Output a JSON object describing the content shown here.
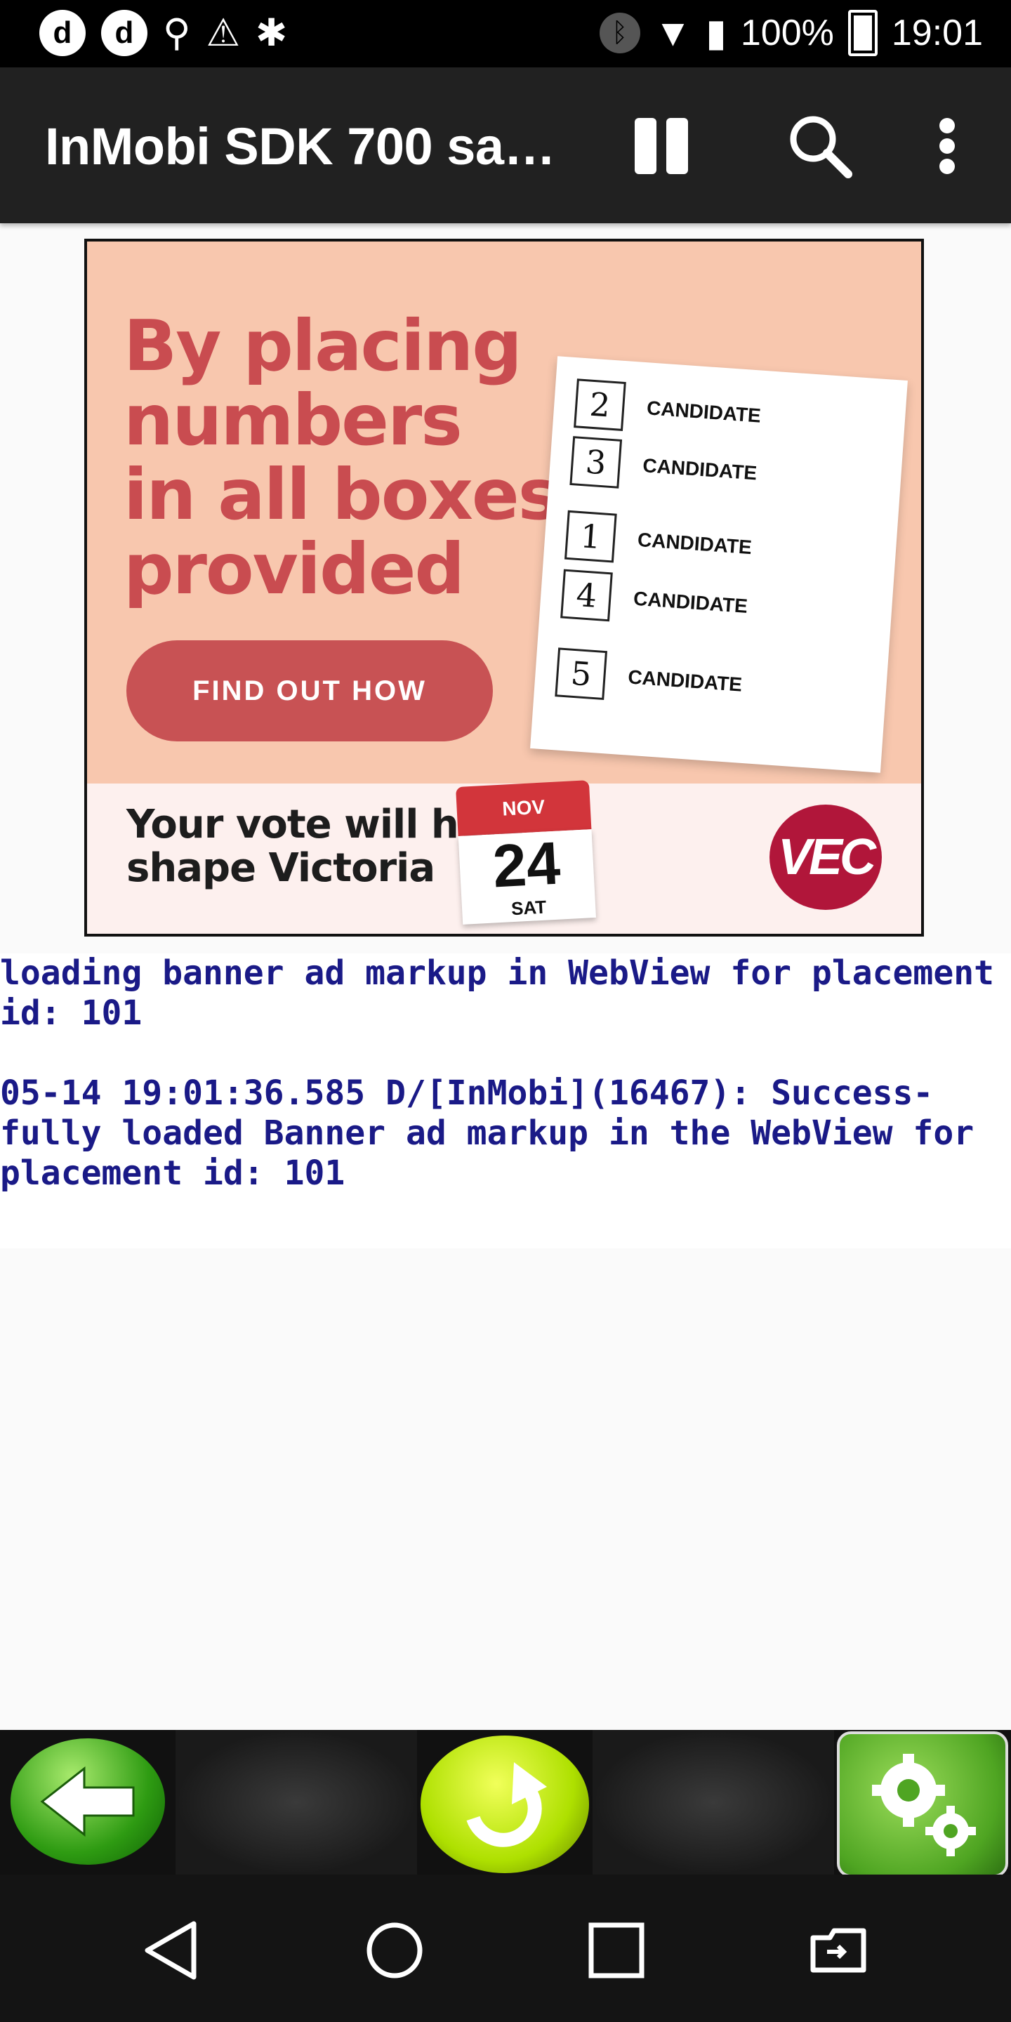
{
  "status_bar": {
    "left_icons": [
      "d-notification-icon",
      "d-notification-icon",
      "usb-icon",
      "warning-icon",
      "android-debug-icon"
    ],
    "left_letters": [
      "d",
      "d"
    ],
    "battery": "100%",
    "time": "19:01"
  },
  "app_bar": {
    "title": "InMobi SDK 700 sa…",
    "actions": [
      "pause-icon",
      "search-icon",
      "more-vert-icon"
    ]
  },
  "ad": {
    "headline": [
      "By placing",
      "numbers",
      "in all boxes",
      "provided"
    ],
    "cta": "FIND OUT HOW",
    "ballot": [
      {
        "num": "2",
        "label": "CANDIDATE"
      },
      {
        "num": "3",
        "label": "CANDIDATE"
      },
      {
        "num": "1",
        "label": "CANDIDATE"
      },
      {
        "num": "4",
        "label": "CANDIDATE"
      },
      {
        "num": "5",
        "label": "CANDIDATE"
      }
    ],
    "slogan": [
      "Your vote will help",
      "shape Victoria"
    ],
    "calendar": {
      "month": "NOV",
      "day": "24",
      "weekday": "SAT"
    },
    "brand": "VEC",
    "colors": {
      "background": "#f8c7ae",
      "accent": "#c85254",
      "brand": "#b1163a"
    }
  },
  "log": {
    "lines": [
      "loading banner ad markup in WebView for placement",
      "id: 101",
      "",
      "05-14 19:01:36.585 D/[InMobi](16467): Success-",
      "fully loaded Banner ad markup in the WebView for",
      "placement id: 101"
    ],
    "color": "#1a1a87"
  },
  "toolbar": {
    "buttons": [
      "back-arrow-icon",
      "redo-icon",
      "settings-gears-icon"
    ]
  },
  "nav_bar": {
    "buttons": [
      "back-icon",
      "home-icon",
      "recents-icon",
      "screen-cast-icon"
    ]
  }
}
